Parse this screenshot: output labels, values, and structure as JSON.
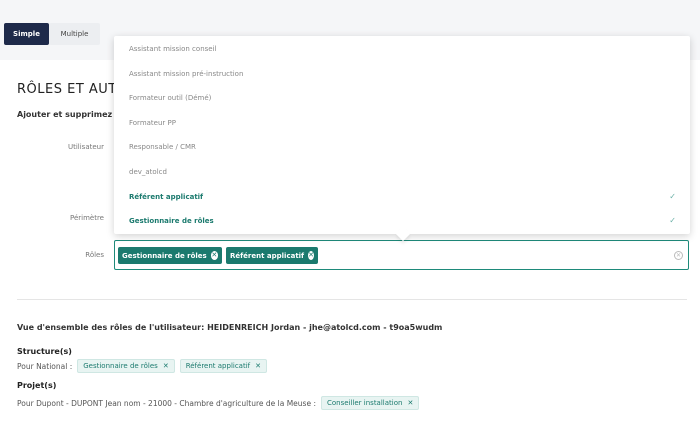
{
  "modes": {
    "simple": "Simple",
    "multiple": "Multiple"
  },
  "section": {
    "title": "RÔLES ET AUTO",
    "subtitle": "Ajouter et supprimez ic"
  },
  "form": {
    "user_label": "Utilisateur",
    "perimeter_label": "Périmètre",
    "roles_label": "Rôles",
    "selected_roles": [
      "Gestionnaire de rôles",
      "Référent applicatif"
    ]
  },
  "dropdown": {
    "items": [
      {
        "label": "Assistant mission conseil",
        "selected": false
      },
      {
        "label": "Assistant mission pré-instruction",
        "selected": false
      },
      {
        "label": "Formateur outil (Démé)",
        "selected": false
      },
      {
        "label": "Formateur PP",
        "selected": false
      },
      {
        "label": "Responsable / CMR",
        "selected": false
      },
      {
        "label": "dev_atolcd",
        "selected": false
      },
      {
        "label": "Référent applicatif",
        "selected": true
      },
      {
        "label": "Gestionnaire de rôles",
        "selected": true
      }
    ],
    "check_glyph": "✓"
  },
  "overview": {
    "title": "Vue d'ensemble des rôles de l'utilisateur: HEIDENREICH Jordan - jhe@atolcd.com - t9oa5wudm",
    "structures_title": "Structure(s)",
    "structures_prefix": "Pour National :",
    "structures_chips": [
      "Gestionnaire de rôles",
      "Référent applicatif"
    ],
    "projects_title": "Projet(s)",
    "projects_prefix": "Pour Dupont - DUPONT Jean nom - 21000 - Chambre d'agriculture de la Meuse :",
    "projects_chips": [
      "Conseiller installation"
    ]
  }
}
